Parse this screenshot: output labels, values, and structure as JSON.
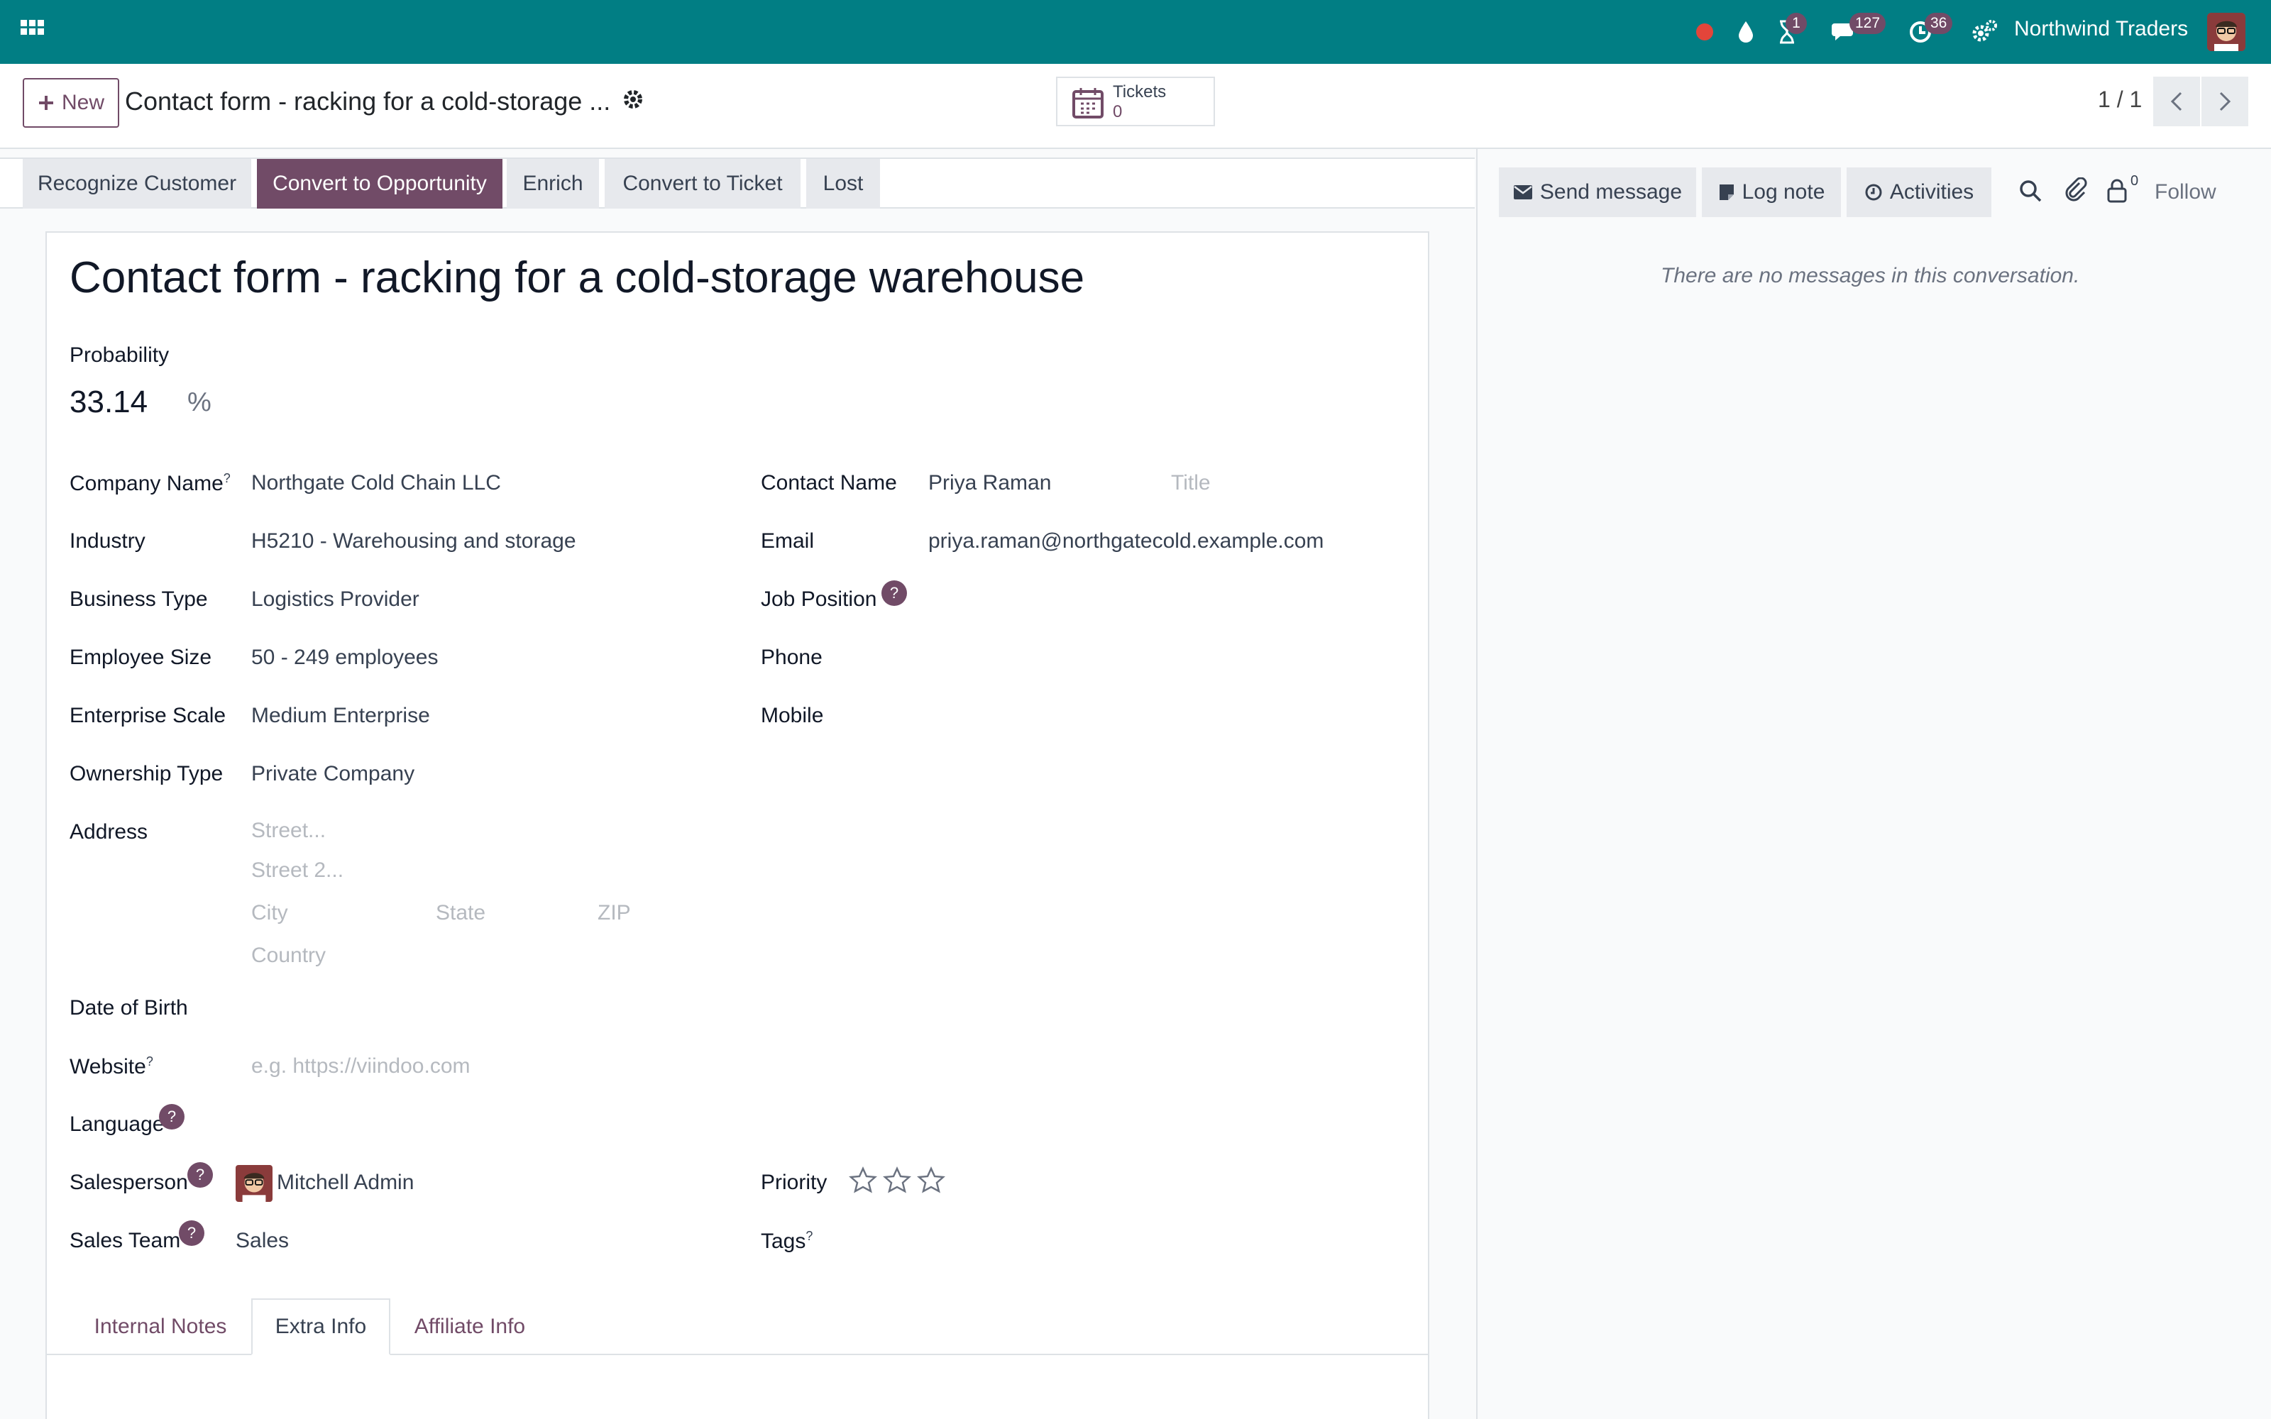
{
  "navbar": {
    "company": "Northwind Traders",
    "activity_badge": "1",
    "messages_badge": "127",
    "timer_badge": "36"
  },
  "control_panel": {
    "new_label": "New",
    "breadcrumb_title": "Contact form - racking for a cold-storage ...",
    "tickets_label": "Tickets",
    "tickets_count": "0",
    "pager": "1 / 1"
  },
  "statusbar": {
    "recognize": "Recognize Customer",
    "convert_opportunity": "Convert to Opportunity",
    "enrich": "Enrich",
    "convert_ticket": "Convert to Ticket",
    "lost": "Lost"
  },
  "form": {
    "title": "Contact form - racking for a cold-storage warehouse",
    "probability_label": "Probability",
    "probability_value": "33.14",
    "probability_unit": "%",
    "left": {
      "company_name_label": "Company Name",
      "company_name": "Northgate Cold Chain LLC",
      "industry_label": "Industry",
      "industry": "H5210 - Warehousing and storage",
      "business_type_label": "Business Type",
      "business_type": "Logistics Provider",
      "employee_size_label": "Employee Size",
      "employee_size": "50 - 249 employees",
      "enterprise_scale_label": "Enterprise Scale",
      "enterprise_scale": "Medium Enterprise",
      "ownership_type_label": "Ownership Type",
      "ownership_type": "Private Company",
      "address_label": "Address",
      "street_ph": "Street...",
      "street2_ph": "Street 2...",
      "city_ph": "City",
      "state_ph": "State",
      "zip_ph": "ZIP",
      "country_ph": "Country",
      "dob_label": "Date of Birth",
      "website_label": "Website",
      "website_ph": "e.g. https://viindoo.com",
      "language_label": "Language",
      "salesperson_label": "Salesperson",
      "salesperson": "Mitchell Admin",
      "sales_team_label": "Sales Team",
      "sales_team": "Sales"
    },
    "right": {
      "contact_name_label": "Contact Name",
      "contact_name": "Priya Raman",
      "title_ph": "Title",
      "email_label": "Email",
      "email": "priya.raman@northgatecold.example.com",
      "job_position_label": "Job Position",
      "phone_label": "Phone",
      "mobile_label": "Mobile",
      "priority_label": "Priority",
      "priority_stars": 0,
      "tags_label": "Tags"
    },
    "help_mark": "?",
    "tabs": [
      "Internal Notes",
      "Extra Info",
      "Affiliate Info"
    ],
    "active_tab": "Extra Info"
  },
  "chatter": {
    "send_message": "Send message",
    "log_note": "Log note",
    "activities": "Activities",
    "followers_count": "0",
    "follow": "Follow",
    "empty": "There are no messages in this conversation."
  },
  "colors": {
    "navbar": "#017e84",
    "brand": "#714b67"
  }
}
